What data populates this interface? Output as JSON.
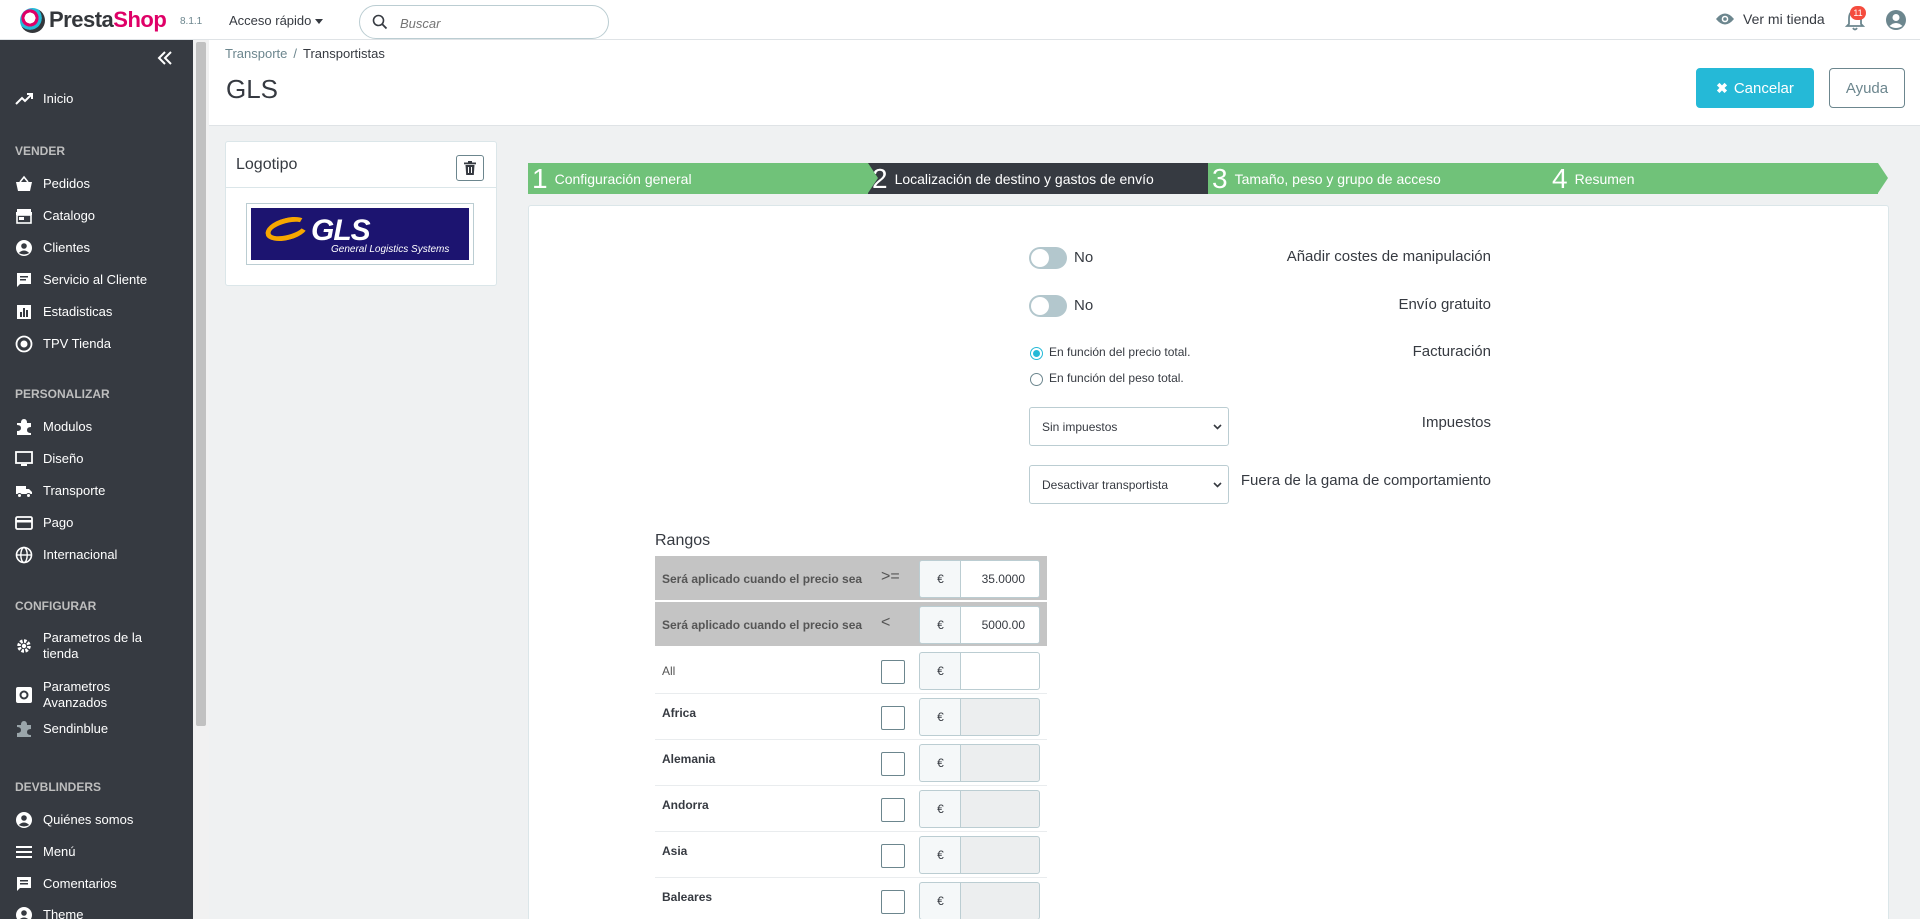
{
  "header": {
    "brand_prefix": "Presta",
    "brand_suffix": "Shop",
    "version": "8.1.1",
    "quick_access": "Acceso rápido",
    "search_placeholder": "Buscar",
    "view_shop": "Ver mi tienda",
    "notifications_count": "11"
  },
  "sidebar": {
    "items_top": [
      {
        "label": "Inicio",
        "icon": "trending-up-icon"
      }
    ],
    "sections": [
      {
        "title": "VENDER",
        "items": [
          {
            "label": "Pedidos",
            "icon": "basket-icon"
          },
          {
            "label": "Catalogo",
            "icon": "store-icon"
          },
          {
            "label": "Clientes",
            "icon": "account-circle-icon"
          },
          {
            "label": "Servicio al Cliente",
            "icon": "chat-icon"
          },
          {
            "label": "Estadisticas",
            "icon": "bar-chart-icon"
          },
          {
            "label": "TPV Tienda",
            "icon": "radio-target-icon"
          }
        ]
      },
      {
        "title": "PERSONALIZAR",
        "items": [
          {
            "label": "Modulos",
            "icon": "puzzle-icon"
          },
          {
            "label": "Diseño",
            "icon": "monitor-icon"
          },
          {
            "label": "Transporte",
            "icon": "truck-icon"
          },
          {
            "label": "Pago",
            "icon": "credit-card-icon"
          },
          {
            "label": "Internacional",
            "icon": "globe-icon"
          }
        ]
      },
      {
        "title": "CONFIGURAR",
        "items": [
          {
            "label": "Parametros de la tienda",
            "icon": "gear-icon"
          },
          {
            "label": "Parametros Avanzados",
            "icon": "settings-box-icon"
          },
          {
            "label": "Sendinblue",
            "icon": "puzzle-icon"
          }
        ]
      },
      {
        "title": "DEVBLINDERS",
        "items": [
          {
            "label": "Quiénes somos",
            "icon": "account-circle-icon"
          },
          {
            "label": "Menú",
            "icon": "menu-icon"
          },
          {
            "label": "Comentarios",
            "icon": "comment-icon"
          },
          {
            "label": "Theme",
            "icon": "account-circle-icon"
          }
        ]
      }
    ]
  },
  "page": {
    "breadcrumb": [
      "Transporte",
      "Transportistas"
    ],
    "breadcrumb_separator": "/",
    "title": "GLS",
    "cancel_label": "Cancelar",
    "help_label": "Ayuda"
  },
  "logo_panel": {
    "title": "Logotipo",
    "logo_word": "GLS",
    "logo_subtitle": "General Logistics Systems"
  },
  "steps": [
    {
      "num": "1",
      "label": "Configuración general",
      "active": false
    },
    {
      "num": "2",
      "label": "Localización de destino y gastos de envío",
      "active": true
    },
    {
      "num": "3",
      "label": "Tamaño, peso y grupo de acceso",
      "active": false
    },
    {
      "num": "4",
      "label": "Resumen",
      "active": false
    }
  ],
  "form": {
    "handling_label": "Añadir costes de manipulación",
    "handling_value": "No",
    "free_label": "Envío gratuito",
    "free_value": "No",
    "billing_label": "Facturación",
    "billing_options": [
      "En función del precio total.",
      "En función del peso total."
    ],
    "billing_selected": 0,
    "tax_label": "Impuestos",
    "tax_value": "Sin impuestos",
    "out_of_range_label": "Fuera de la gama de comportamiento",
    "out_of_range_value": "Desactivar transportista"
  },
  "ranges": {
    "title": "Rangos",
    "currency": "€",
    "rows": [
      {
        "label": "Será aplicado cuando el precio sea",
        "op": ">=",
        "value": "35.0000"
      },
      {
        "label": "Será aplicado cuando el precio sea",
        "op": "<",
        "value": "5000.00"
      }
    ],
    "zones": [
      "All",
      "Africa",
      "Alemania",
      "Andorra",
      "Asia",
      "Baleares"
    ]
  },
  "colors": {
    "sidebar_bg": "#363a41",
    "accent": "#25b9d7",
    "step_done": "#70c279",
    "step_active": "#363a41",
    "brand_pink": "#df0067"
  }
}
